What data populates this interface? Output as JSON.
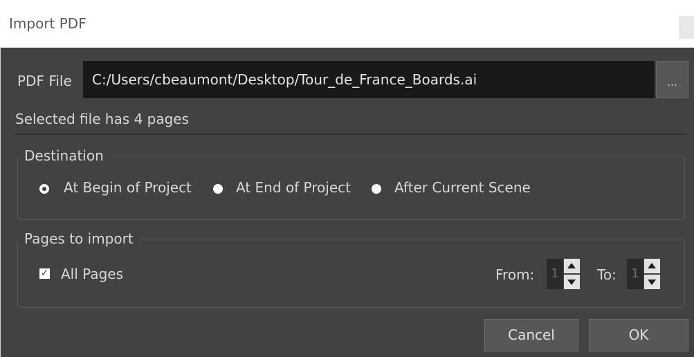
{
  "window": {
    "title": "Import PDF"
  },
  "file": {
    "label": "PDF File",
    "path": "C:/Users/cbeaumont/Desktop/Tour_de_France_Boards.ai",
    "browse_label": "...",
    "info": "Selected file has 4 pages"
  },
  "destination": {
    "title": "Destination",
    "options": [
      {
        "label": "At Begin of Project",
        "selected": true
      },
      {
        "label": "At End of Project",
        "selected": false
      },
      {
        "label": "After Current Scene",
        "selected": false
      }
    ]
  },
  "pages": {
    "title": "Pages to import",
    "all_pages_label": "All Pages",
    "all_pages_checked": true,
    "from_label": "From:",
    "from_value": "1",
    "to_label": "To:",
    "to_value": "1"
  },
  "buttons": {
    "cancel": "Cancel",
    "ok": "OK"
  },
  "colors": {
    "dialog_bg": "#424242",
    "field_bg": "#191919",
    "text": "#d8d8d8"
  }
}
